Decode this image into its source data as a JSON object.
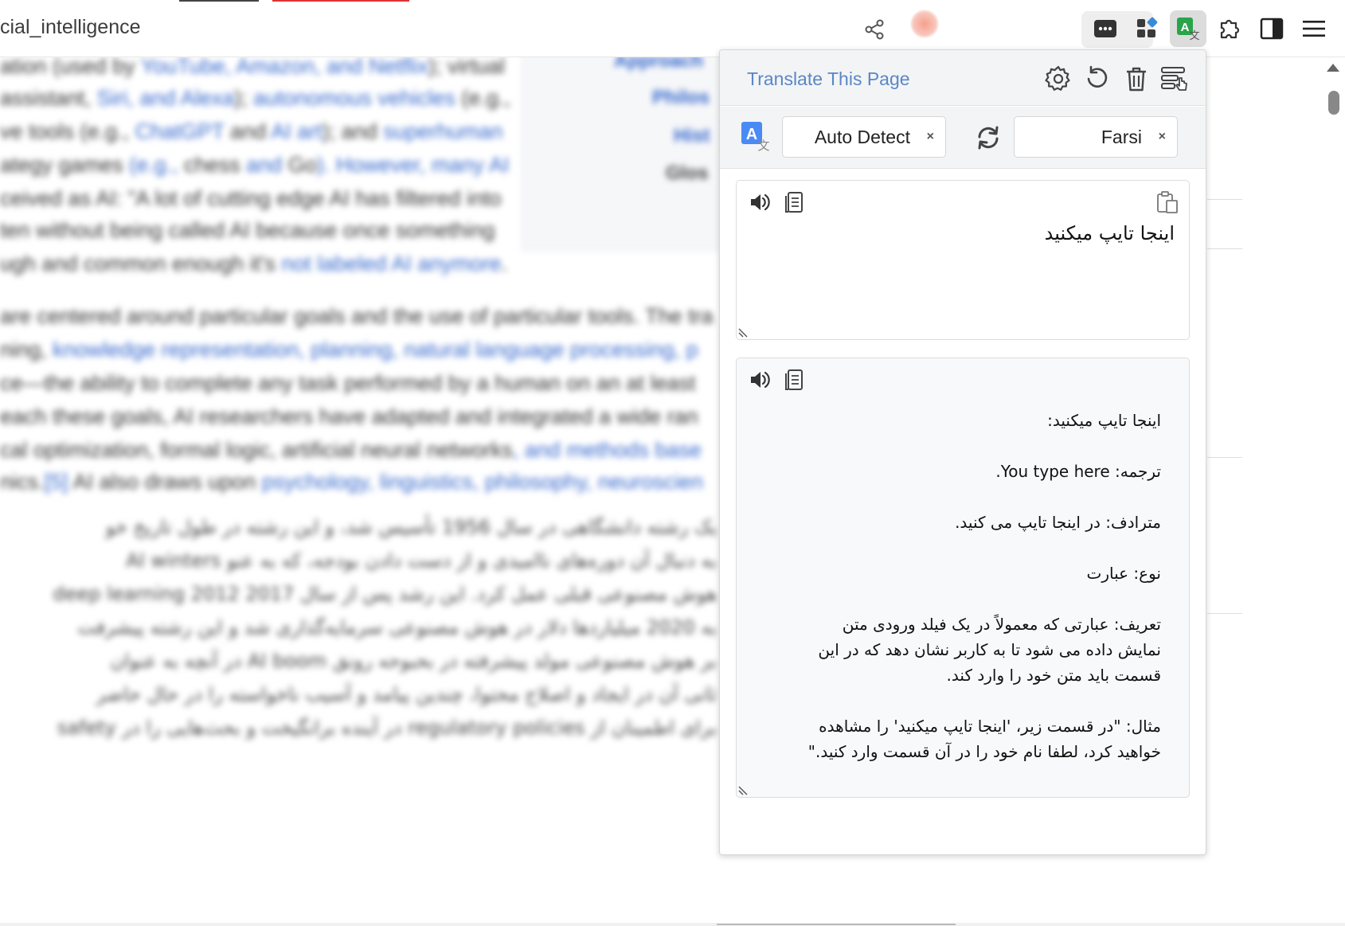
{
  "browser": {
    "url_fragment": "cial_intelligence"
  },
  "background_page": {
    "infobox_items": [
      "Approach",
      "Philos",
      "Hist",
      "Glos"
    ],
    "lines": [
      [
        "ation (used by ",
        "YouTube, Amazon, and Netflix",
        "); virtual"
      ],
      [
        "assistant, ",
        "Siri, and Alexa",
        "); ",
        "autonomous vehicles",
        " (e.g.,"
      ],
      [
        "ve tools (e.g., ",
        "ChatGPT",
        " and ",
        "AI art",
        "); and ",
        "superhuman"
      ],
      [
        "ategy games",
        " (e.g., ",
        "chess",
        " and ",
        "Go",
        "). However, many AI"
      ],
      [
        "ceived as AI: \"A lot of cutting edge AI has filtered into"
      ],
      [
        "ten without being called AI because once something"
      ],
      [
        "ugh and common enough it's ",
        "not labeled AI anymore",
        "."
      ],
      [
        "are centered around particular goals and the use of particular tools. The tra"
      ],
      [
        "ning, ",
        "knowledge representation, planning, natural language processing, p"
      ],
      [
        "ce—the ability to complete any task performed by a human on an at least"
      ],
      [
        "each these goals, AI researchers have adapted and integrated a wide ran"
      ],
      [
        "cal optimization, formal logic, artificial neural networks",
        ", and methods base"
      ],
      [
        "nics.",
        "[5]",
        " AI also draws upon ",
        "psychology, linguistics, philosophy, neuroscien"
      ]
    ],
    "fa_lines": [
      "یک رشته دانشگاهی در سال 1956 تأسیس شد، و این رشته در طول تاریخ خو",
      "به دنبال آن دوره‌های ناامیدی و از دست دادن بودجه، که به عنو AI winters",
      "هوش مصنوعی قبلی عمل کرد. این رشد پس از سال 2017 deep learning 2012",
      "به 2020 میلیاردها دلار در هوش مصنوعی سرمایه‌گذاری شد و این رشته پیشرفت",
      "بر هوش مصنوعی مولد پیشرفته در بحبوحه رونق AI boom در آنچه به عنوان",
      "ثانی آن در ایجاد و اصلاح محتوا، چندین پیامد و آسیب ناخواسته را در حال حاضر",
      "برای اطمینان از regulatory policies در آینده برانگیخت و بحث‌هایی را در safety"
    ]
  },
  "popup": {
    "title": "Translate This Page",
    "source_language": "Auto Detect",
    "target_language": "Farsi",
    "input_text": "اینجا تایپ میکنید",
    "output_text": "اینجا تایپ میکنید:\n\nترجمه: You type here.\n\nمترادف: در اینجا تایپ می کنید.\n\nنوع: عبارت\n\nتعریف: عبارتی که معمولاً در یک فیلد ورودی متن\nنمایش داده می شود تا به کاربر نشان دهد که در این\nقسمت باید متن خود را وارد کند.\n\nمثال: \"در قسمت زیر، 'اینجا تایپ میکنید' را مشاهده\nخواهید کرد، لطفا نام خود را در آن قسمت وارد کنید.\"",
    "clear_glyph": "×",
    "colors": {
      "title": "#5a87c5",
      "translate_icon_blue": "#4a8af4",
      "extension_green": "#2aa44a"
    }
  }
}
